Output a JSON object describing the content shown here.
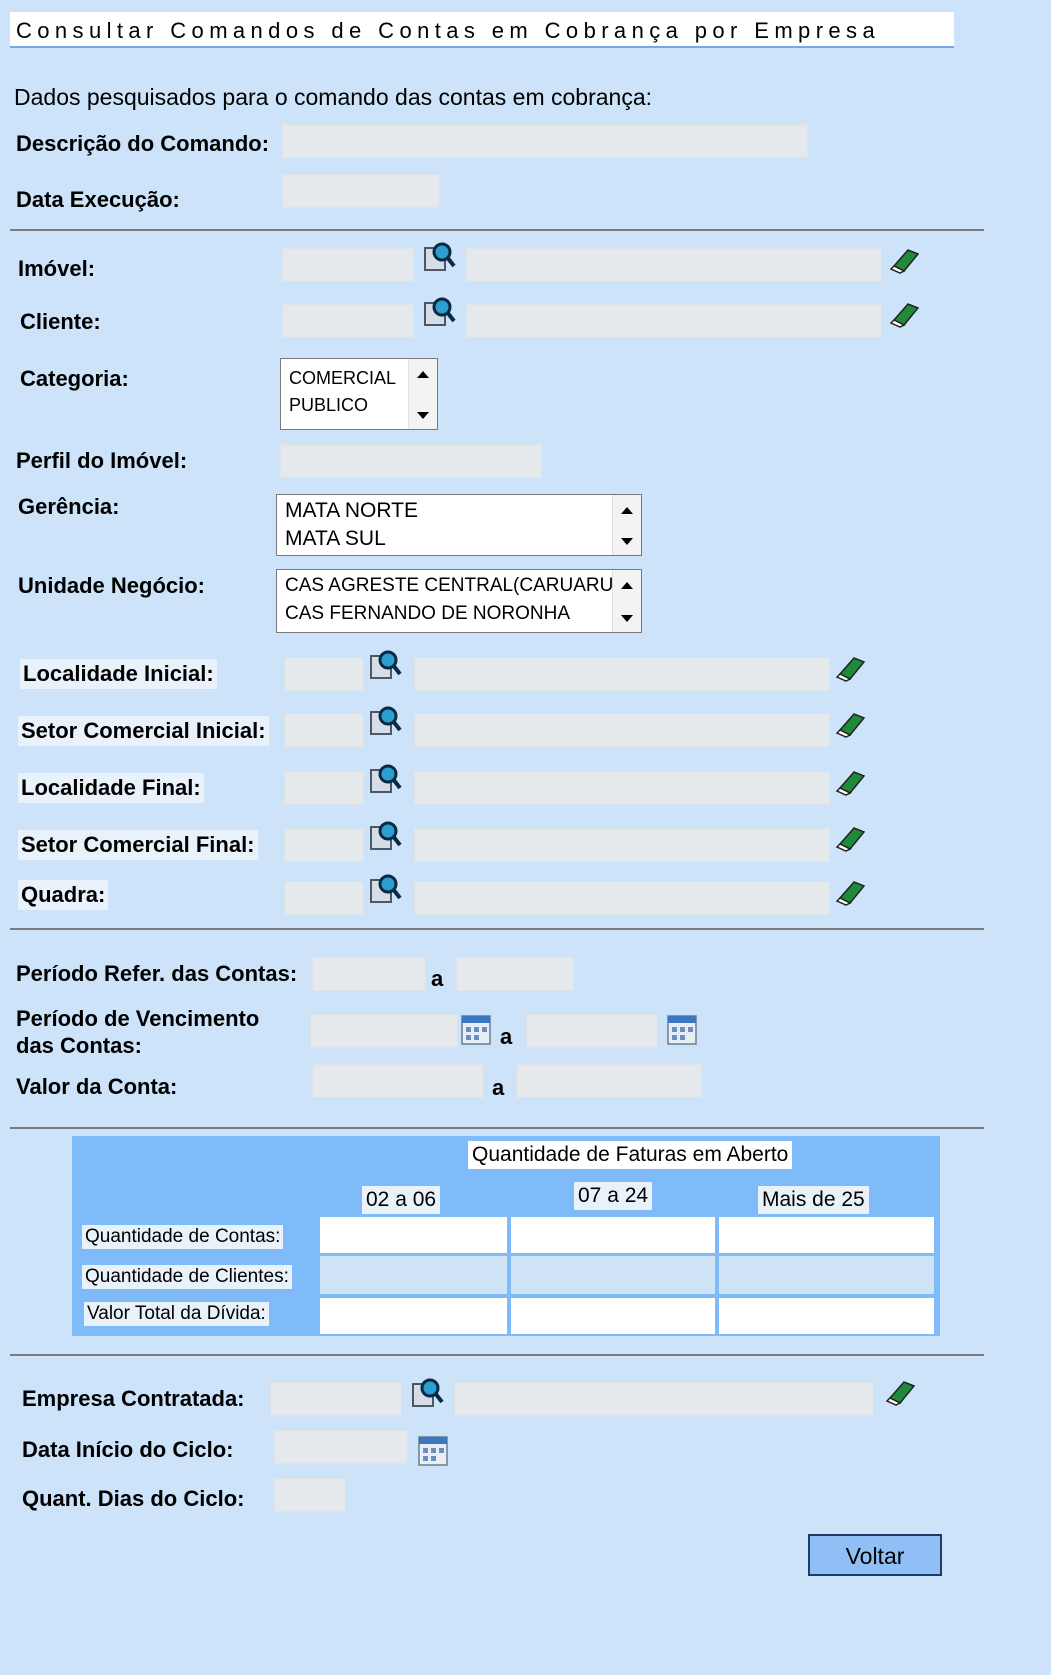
{
  "title": "Consultar Comandos de Contas em Cobrança por Empresa",
  "subtitle": "Dados pesquisados para o comando das contas em cobrança:",
  "labels": {
    "descricao": "Descrição do Comando:",
    "data_execucao": "Data Execução:",
    "imovel": "Imóvel:",
    "cliente": "Cliente:",
    "categoria": "Categoria:",
    "perfil": "Perfil do Imóvel:",
    "gerencia": "Gerência:",
    "unidade": "Unidade Negócio:",
    "localidade_inicial": "Localidade Inicial:",
    "setor_inicial": "Setor Comercial Inicial:",
    "localidade_final": "Localidade Final:",
    "setor_final": "Setor Comercial Final:",
    "quadra": "Quadra:",
    "periodo_ref": "Período Refer. das Contas:",
    "periodo_venc_1": "Período de Vencimento",
    "periodo_venc_2": "das Contas:",
    "valor_conta": "Valor da Conta:",
    "a": "a",
    "empresa": "Empresa Contratada:",
    "data_inicio": "Data Início do Ciclo:",
    "quant_dias": "Quant. Dias do Ciclo:"
  },
  "categoria_options": [
    "COMERCIAL",
    "PUBLICO"
  ],
  "gerencia_options": [
    "MATA NORTE",
    "MATA SUL"
  ],
  "unidade_options": [
    "CAS AGRESTE CENTRAL(CARUARU",
    "CAS FERNANDO DE NORONHA"
  ],
  "table": {
    "header": "Quantidade de Faturas em Aberto",
    "columns": [
      "02 a 06",
      "07 a 24",
      "Mais de 25"
    ],
    "rows": [
      "Quantidade de Contas:",
      "Quantidade de Clientes:",
      "Valor Total da Dívida:"
    ]
  },
  "buttons": {
    "voltar": "Voltar"
  }
}
